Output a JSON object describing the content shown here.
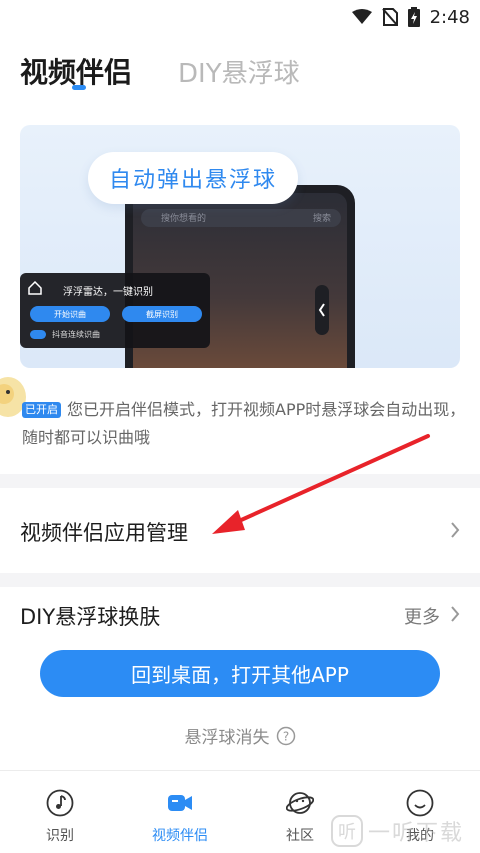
{
  "status_bar": {
    "time": "2:48"
  },
  "tabs": [
    {
      "label": "视频伴侣",
      "active": true
    },
    {
      "label": "DIY悬浮球",
      "active": false
    }
  ],
  "banner": {
    "bubble_text": "自动弹出悬浮球",
    "phone_search_placeholder": "搜你想看的",
    "phone_search_button": "搜索",
    "panel_title": "浮浮雷达，一键识别",
    "panel_button_start": "开始识曲",
    "panel_button_screenshot": "截屏识别",
    "panel_toggle_label": "抖音连续识曲"
  },
  "info": {
    "badge": "已开启",
    "text": "您已开启伴侣模式，打开视频APP时悬浮球会自动出现，随时都可以识曲哦"
  },
  "app_management": {
    "label": "视频伴侣应用管理"
  },
  "diy_skin": {
    "label": "DIY悬浮球换肤",
    "more": "更多"
  },
  "cta": {
    "label": "回到桌面，打开其他APP"
  },
  "disappear": {
    "label": "悬浮球消失"
  },
  "bottom_nav": [
    {
      "label": "识别",
      "icon": "music-note-icon",
      "active": false
    },
    {
      "label": "视频伴侣",
      "icon": "video-icon",
      "active": true
    },
    {
      "label": "社区",
      "icon": "planet-icon",
      "active": false
    },
    {
      "label": "我的",
      "icon": "smile-icon",
      "active": false
    }
  ],
  "watermark": {
    "text": "一听下载"
  },
  "colors": {
    "accent": "#2c8cf4",
    "arrow": "#e8232a"
  }
}
